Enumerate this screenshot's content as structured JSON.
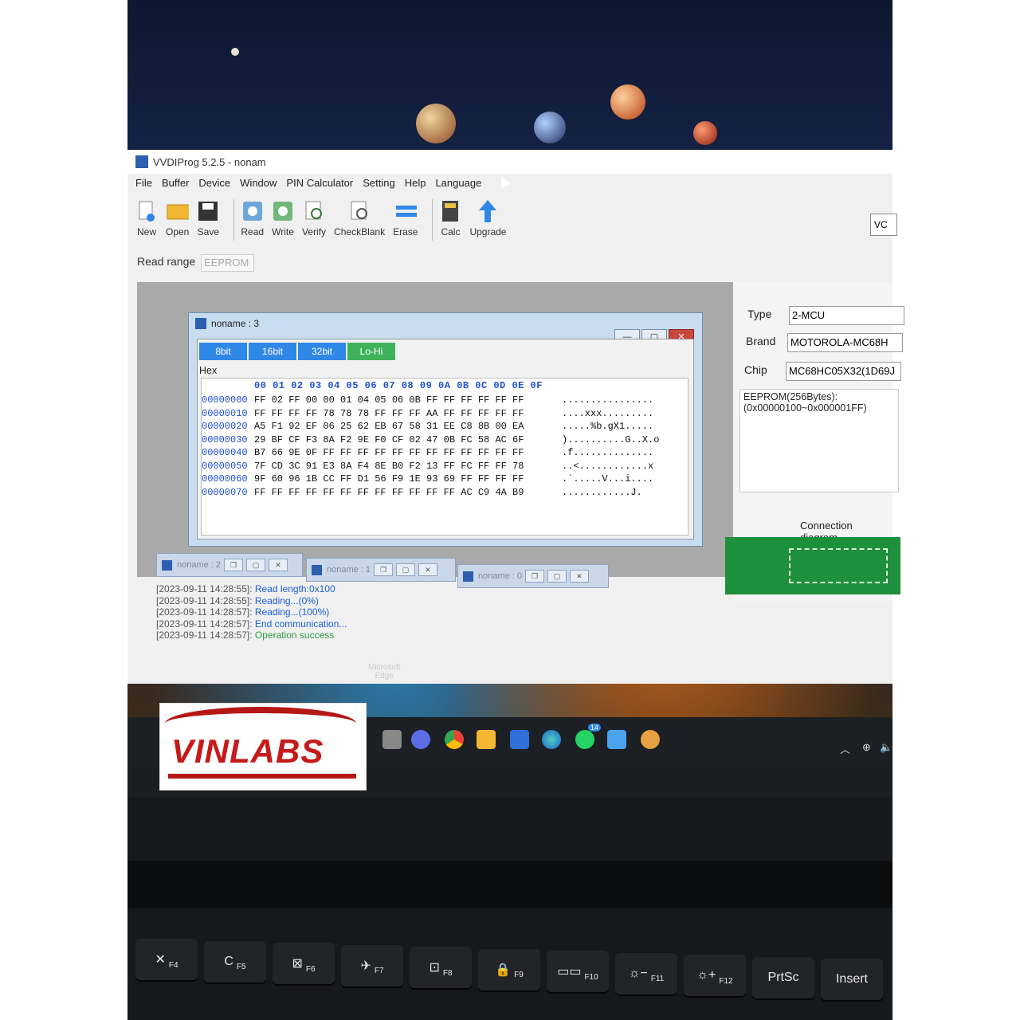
{
  "window": {
    "title": "VVDIProg 5.2.5 - nonam"
  },
  "menu": [
    "File",
    "Buffer",
    "Device",
    "Window",
    "PIN Calculator",
    "Setting",
    "Help",
    "Language"
  ],
  "toolbar": [
    {
      "label": "New",
      "icon": "new-file-icon"
    },
    {
      "label": "Open",
      "icon": "folder-icon"
    },
    {
      "label": "Save",
      "icon": "save-icon"
    },
    {
      "label": "Read",
      "icon": "read-chip-icon"
    },
    {
      "label": "Write",
      "icon": "write-chip-icon"
    },
    {
      "label": "Verify",
      "icon": "verify-icon"
    },
    {
      "label": "CheckBlank",
      "icon": "checkblank-icon"
    },
    {
      "label": "Erase",
      "icon": "erase-icon"
    },
    {
      "label": "Calc",
      "icon": "calculator-icon"
    },
    {
      "label": "Upgrade",
      "icon": "upgrade-arrow-icon"
    }
  ],
  "read_range": {
    "label": "Read range",
    "value": "EEPROM"
  },
  "right_panel": {
    "type_label": "Type",
    "type_value": "2-MCU",
    "brand_label": "Brand",
    "brand_value": "MOTOROLA-MC68H",
    "chip_label": "Chip",
    "chip_value": "MC68HC05X32(1D69J",
    "info_line1": "EEPROM(256Bytes):",
    "info_line2": "(0x00000100~0x000001FF)",
    "connection_label": "Connection diagram",
    "vcc_label": "VC"
  },
  "hex_window": {
    "title": "noname : 3",
    "modes": [
      "8bit",
      "16bit",
      "32bit",
      "Lo-Hi"
    ],
    "legend": "Hex",
    "header": "00 01 02 03 04 05 06 07 08 09 0A 0B 0C 0D 0E 0F",
    "rows": [
      {
        "addr": "00000000",
        "bytes": "FF 02 FF 00 00 01 04 05 06 0B FF FF FF FF FF FF",
        "ascii": "................"
      },
      {
        "addr": "00000010",
        "bytes": "FF FF FF FF 78 78 78 FF FF FF AA FF FF FF FF FF",
        "ascii": "....xxx........."
      },
      {
        "addr": "00000020",
        "bytes": "A5 F1 92 EF 06 25 62 EB 67 58 31 EE C8 8B 00 EA",
        "ascii": ".....%b.gX1....."
      },
      {
        "addr": "00000030",
        "bytes": "29 BF CF F3 8A F2 9E F0 CF 02 47 0B FC 58 AC 6F",
        "ascii": ")..........G..X.o"
      },
      {
        "addr": "00000040",
        "bytes": "B7 66 9E 0F FF FF FF FF FF FF FF FF FF FF FF FF",
        "ascii": ".f.............."
      },
      {
        "addr": "00000050",
        "bytes": "7F CD 3C 91 E3 8A F4 8E B0 F2 13 FF FC FF FF 78",
        "ascii": "..<............x"
      },
      {
        "addr": "00000060",
        "bytes": "9F 60 96 1B CC FF D1 56 F9 1E 93 69 FF FF FF FF",
        "ascii": ".`.....V...i...."
      },
      {
        "addr": "00000070",
        "bytes": "FF FF FF FF FF FF FF FF FF FF FF FF AC C9 4A B9",
        "ascii": "............J."
      }
    ]
  },
  "minimized": [
    "noname : 2",
    "noname : 1",
    "noname : 0"
  ],
  "log": [
    {
      "ts": "[2023-09-11 14:28:55]",
      "msg": ": Read length:0x100",
      "ok": false
    },
    {
      "ts": "[2023-09-11 14:28:55]",
      "msg": ": Reading...(0%)",
      "ok": false
    },
    {
      "ts": "[2023-09-11 14:28:57]",
      "msg": ": Reading...(100%)",
      "ok": false
    },
    {
      "ts": "[2023-09-11 14:28:57]",
      "msg": ": End communication...",
      "ok": false
    },
    {
      "ts": "[2023-09-11 14:28:57]",
      "msg": ": Operation success",
      "ok": true
    }
  ],
  "desktop": {
    "edge_label_1": "Microsoft",
    "edge_label_2": "Edge"
  },
  "taskbar_badge": "14",
  "logo_text": "VINLABS",
  "keys": [
    {
      "label": "✕",
      "sub": "F4"
    },
    {
      "label": "C",
      "sub": "F5"
    },
    {
      "label": "⊠",
      "sub": "F6"
    },
    {
      "label": "✈",
      "sub": "F7"
    },
    {
      "label": "⊡",
      "sub": "F8"
    },
    {
      "label": "🔒",
      "sub": "F9"
    },
    {
      "label": "▭▭",
      "sub": "F10"
    },
    {
      "label": "☼−",
      "sub": "F11"
    },
    {
      "label": "☼+",
      "sub": "F12"
    },
    {
      "label": "PrtSc",
      "sub": ""
    },
    {
      "label": "Insert",
      "sub": ""
    }
  ]
}
